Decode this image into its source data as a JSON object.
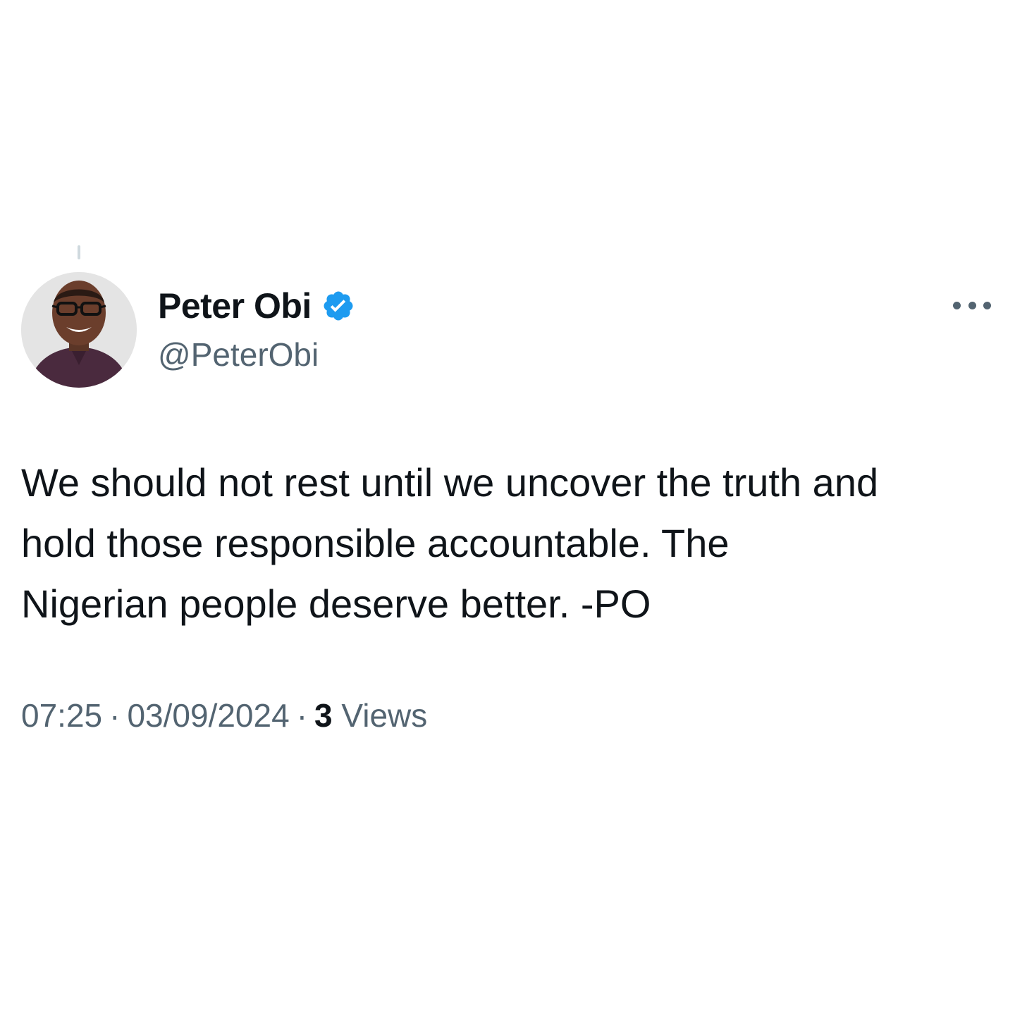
{
  "tweet": {
    "author": {
      "display_name": "Peter Obi",
      "handle": "@PeterObi",
      "verified": true,
      "verified_badge_color": "#1d9bf0"
    },
    "text": "We should not rest until we uncover the truth and\nhold those responsible accountable. The\nNigerian people deserve better. -PO",
    "time": "07:25",
    "date": "03/09/2024",
    "separator": "·",
    "views_count": "3",
    "views_label": "Views",
    "icons": {
      "more": "more-horizontal-icon",
      "verified": "verified-badge-icon"
    }
  },
  "colors": {
    "background": "#ffffff",
    "primary_text": "#0f1419",
    "secondary_text": "#536471",
    "accent": "#1d9bf0"
  }
}
